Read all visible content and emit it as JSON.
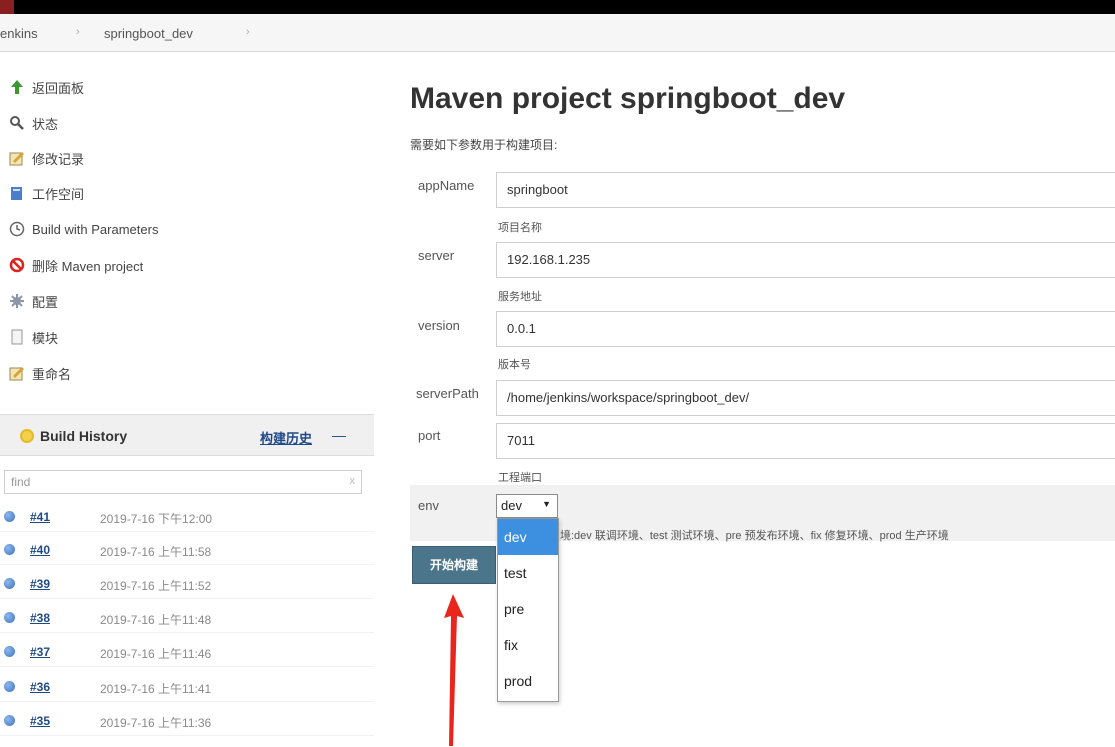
{
  "breadcrumb": {
    "items": [
      "enkins",
      "springboot_dev"
    ],
    "sep": "›"
  },
  "sidebar": {
    "tasks": [
      {
        "label": "返回面板",
        "icon": "up-arrow-icon"
      },
      {
        "label": "状态",
        "icon": "magnifier-icon"
      },
      {
        "label": "修改记录",
        "icon": "notepad-icon"
      },
      {
        "label": "工作空间",
        "icon": "folder-icon"
      },
      {
        "label": "Build with Parameters",
        "icon": "clock-icon"
      },
      {
        "label": "删除 Maven project",
        "icon": "no-entry-icon"
      },
      {
        "label": "配置",
        "icon": "gear-icon"
      },
      {
        "label": "模块",
        "icon": "document-icon"
      },
      {
        "label": "重命名",
        "icon": "notepad-icon"
      }
    ]
  },
  "build_history": {
    "title": "Build History",
    "trend_label": "构建历史",
    "trend_suffix": "—",
    "filter_placeholder": "find",
    "filter_clear": "x",
    "builds": [
      {
        "number": "#41",
        "date": "2019-7-16 下午12:00"
      },
      {
        "number": "#40",
        "date": "2019-7-16 上午11:58"
      },
      {
        "number": "#39",
        "date": "2019-7-16 上午11:52"
      },
      {
        "number": "#38",
        "date": "2019-7-16 上午11:48"
      },
      {
        "number": "#37",
        "date": "2019-7-16 上午11:46"
      },
      {
        "number": "#36",
        "date": "2019-7-16 上午11:41"
      },
      {
        "number": "#35",
        "date": "2019-7-16 上午11:36"
      }
    ]
  },
  "main": {
    "title": "Maven project springboot_dev",
    "subtitle": "需要如下参数用于构建项目:",
    "params": [
      {
        "name": "appName",
        "value": "springboot",
        "desc": "项目名称"
      },
      {
        "name": "server",
        "value": "192.168.1.235",
        "desc": "服务地址"
      },
      {
        "name": "version",
        "value": "0.0.1",
        "desc": "版本号"
      },
      {
        "name": "serverPath",
        "value": "/home/jenkins/workspace/springboot_dev/",
        "desc": ""
      },
      {
        "name": "port",
        "value": "7011",
        "desc": "工程端口"
      }
    ],
    "env": {
      "name": "env",
      "selected": "dev",
      "desc": "境:dev 联调环境、test 测试环境、pre 预发布环境、fix 修复环境、prod 生产环境",
      "options": [
        "dev",
        "test",
        "pre",
        "fix",
        "prod"
      ],
      "highlighted": "dev"
    },
    "build_button": "开始构建"
  },
  "colors": {
    "link": "#204a87",
    "button": "#4b758b",
    "dropdown_highlight": "#3d8fe0",
    "annotation_arrow": "#e8261e"
  }
}
